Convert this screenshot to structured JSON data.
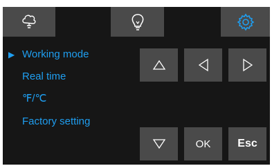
{
  "topbar": {
    "home_icon": "cloud-icon",
    "light_icon": "light-bulb-icon",
    "settings_icon": "gear-icon",
    "accent_color": "#1f9ef0"
  },
  "menu": {
    "selected_index": 0,
    "items": [
      {
        "label": "Working mode"
      },
      {
        "label": "Real time"
      },
      {
        "label": "℉/℃"
      },
      {
        "label": "Factory setting"
      }
    ]
  },
  "keypad": {
    "up_icon": "triangle-up-icon",
    "left_icon": "triangle-left-icon",
    "right_icon": "triangle-right-icon",
    "down_icon": "triangle-down-icon",
    "ok_label": "OK",
    "esc_label": "Esc"
  }
}
